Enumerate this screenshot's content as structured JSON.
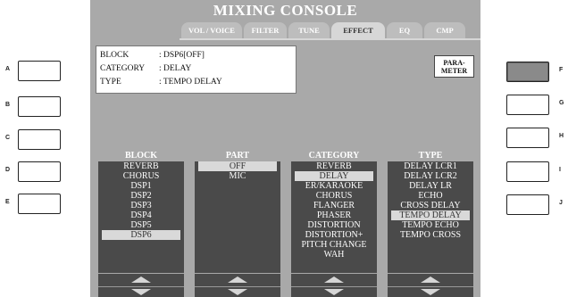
{
  "title": "MIXING CONSOLE",
  "tabs": [
    {
      "label": "VOL / VOICE",
      "active": false
    },
    {
      "label": "FILTER",
      "active": false
    },
    {
      "label": "TUNE",
      "active": false
    },
    {
      "label": "EFFECT",
      "active": true
    },
    {
      "label": "EQ",
      "active": false
    },
    {
      "label": "CMP",
      "active": false
    }
  ],
  "info": {
    "block_label": "BLOCK",
    "block_value": ": DSP6[OFF]",
    "category_label": "CATEGORY",
    "category_value": ": DELAY",
    "type_label": "TYPE",
    "type_value": ": TEMPO DELAY"
  },
  "parameter_button": {
    "line1": "PARA-",
    "line2": "METER"
  },
  "left_buttons": [
    "A",
    "B",
    "C",
    "D",
    "E"
  ],
  "right_buttons": [
    "F",
    "G",
    "H",
    "I",
    "J"
  ],
  "active_right_button": "F",
  "columns": {
    "block": {
      "header": "BLOCK",
      "items": [
        "REVERB",
        "CHORUS",
        "DSP1",
        "DSP2",
        "DSP3",
        "DSP4",
        "DSP5",
        "DSP6"
      ],
      "selected": "DSP6"
    },
    "part": {
      "header": "PART",
      "items": [
        "OFF",
        "MIC"
      ],
      "selected": "OFF"
    },
    "category": {
      "header": "CATEGORY",
      "items": [
        "REVERB",
        "DELAY",
        "ER/KARAOKE",
        "CHORUS",
        "FLANGER",
        "PHASER",
        "DISTORTION",
        "DISTORTION+",
        "PITCH CHANGE",
        "WAH"
      ],
      "selected": "DELAY"
    },
    "type": {
      "header": "TYPE",
      "items": [
        "DELAY LCR1",
        "DELAY LCR2",
        "DELAY LR",
        "ECHO",
        "CROSS DELAY",
        "TEMPO DELAY",
        "TEMPO ECHO",
        "TEMPO CROSS"
      ],
      "selected": "TEMPO DELAY"
    }
  },
  "colors": {
    "lcd_background": "#a9a9a9",
    "list_background": "#4a4a4a",
    "selection": "#d9d9d9"
  }
}
